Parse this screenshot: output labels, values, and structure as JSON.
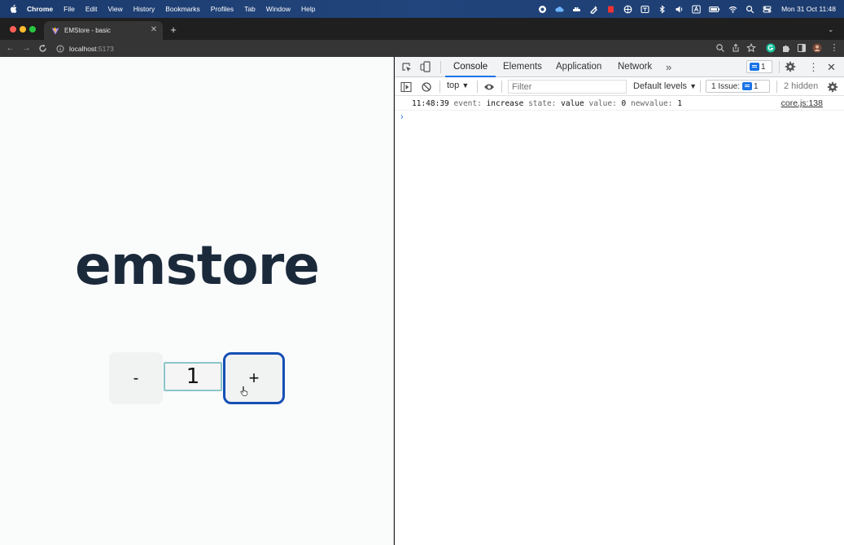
{
  "menubar": {
    "app": "Chrome",
    "items": [
      "File",
      "Edit",
      "View",
      "History",
      "Bookmarks",
      "Profiles",
      "Tab",
      "Window",
      "Help"
    ],
    "clock": "Mon 31 Oct  11:48"
  },
  "browser": {
    "tab_title": "EMStore - basic",
    "url_host": "localhost",
    "url_port": ":5173"
  },
  "page": {
    "brand": "emstore",
    "stepper": {
      "minus_label": "-",
      "value": "1",
      "plus_label": "+"
    }
  },
  "devtools": {
    "tabs": [
      "Console",
      "Elements",
      "Application",
      "Network"
    ],
    "active_tab": "Console",
    "messages_badge": "1",
    "context": "top",
    "filter_placeholder": "Filter",
    "levels": "Default levels",
    "issues_label": "1 Issue:",
    "issues_count": "1",
    "hidden": "2 hidden",
    "log": {
      "time": "11:48:39",
      "k_event": "event:",
      "v_event": "increase",
      "k_state": "state:",
      "v_state": "value",
      "k_value": "value:",
      "v_value": "0",
      "k_newvalue": "newvalue:",
      "v_newvalue": "1",
      "source": "core.js:138"
    },
    "prompt": "›"
  },
  "colors": {
    "menubar": "#21457c",
    "brand_text": "#1b2a3b",
    "focus_ring": "#1450b4",
    "input_border": "#8cc5c9",
    "devtools_accent": "#1a73e8"
  }
}
